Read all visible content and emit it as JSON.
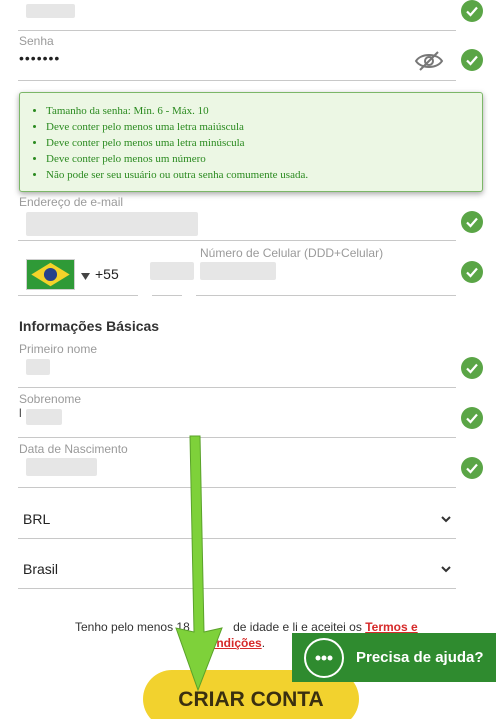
{
  "password": {
    "label": "Senha",
    "masked_value": "•••••••",
    "hide_icon": "eye-slash-icon"
  },
  "password_rules": [
    "Tamanho da senha: Mín. 6 - Máx. 10",
    "Deve conter pelo menos uma letra maiúscula",
    "Deve conter pelo menos uma letra minúscula",
    "Deve conter pelo menos um número",
    "Não pode ser seu usuário ou outra senha comumente usada."
  ],
  "email": {
    "label": "Endereço de e-mail"
  },
  "phone": {
    "country_code": "+55",
    "label": "Número de Celular (DDD+Celular)",
    "flag": "brazil-flag-icon"
  },
  "basic_info": {
    "title": "Informações Básicas",
    "first_name_label": "Primeiro nome",
    "last_name_label": "Sobrenome",
    "last_name_partial": "l",
    "birth_date_label": "Data de Nascimento"
  },
  "currency": {
    "value": "BRL"
  },
  "country": {
    "value": "Brasil"
  },
  "terms": {
    "text_before": "Tenho pelo menos 18",
    "text_hidden_part": "anos de idade",
    "text_middle": "de idade e li e aceitei os",
    "link_part1": "Termos e",
    "link_part2": "ondições",
    "text_end": "."
  },
  "create_button": {
    "label": "CRIAR CONTA"
  },
  "help": {
    "label": "Precisa de ajuda?"
  },
  "colors": {
    "check": "#5aa546",
    "button": "#f2d22e",
    "help": "#2f8b2f",
    "link": "#d62a2a",
    "arrow": "#7ed13a"
  }
}
